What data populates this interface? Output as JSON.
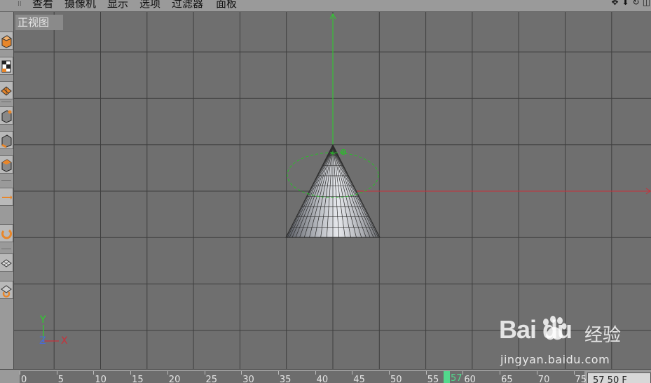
{
  "menubar": {
    "items": [
      "查看",
      "摄像机",
      "显示",
      "选项",
      "过滤器",
      "面板"
    ],
    "nav_icons": [
      "move-view-icon",
      "zoom-view-icon",
      "rotate-view-icon",
      "toggle-view-icon"
    ]
  },
  "toolbar": {
    "tools": [
      "view-cube-icon",
      "checker-icon",
      "texture-icon",
      "point-mode-icon",
      "edge-mode-icon",
      "polygon-mode-icon",
      "move-tool-icon",
      "rotate-tool-icon",
      "plane-icon",
      "workplane-icon"
    ]
  },
  "viewport": {
    "view_label": "正视图",
    "axis_y": "Y",
    "axis_z": "Z",
    "axis_x": "X",
    "colors": {
      "background": "#6f6f6f",
      "grid": "#3f3f3f",
      "x_axis": "#c8313b",
      "y_axis": "#2bd22b",
      "selection": "#27c027"
    },
    "object": "cone"
  },
  "watermark": {
    "logo": "Bai du",
    "chinese": "经验",
    "url": "jingyan.baidu.com"
  },
  "timeline": {
    "ticks": [
      "0",
      "5",
      "10",
      "15",
      "20",
      "25",
      "30",
      "35",
      "40",
      "45",
      "50",
      "55",
      "60",
      "65",
      "70",
      "75"
    ],
    "current_frame_label": "57",
    "frame_field": "57 50 F"
  }
}
